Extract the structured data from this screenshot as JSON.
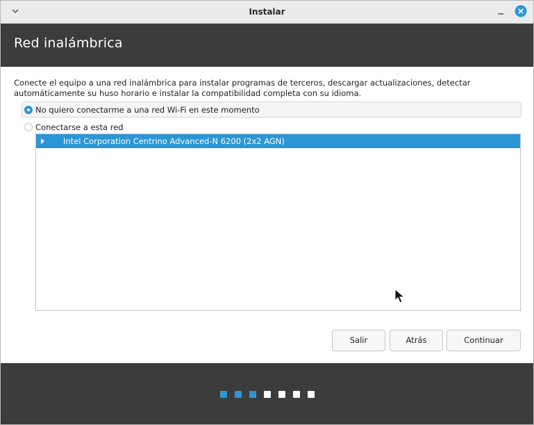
{
  "window": {
    "title": "Instalar"
  },
  "header": {
    "title": "Red inalámbrica"
  },
  "description": "Conecte el equipo a una red inalámbrica para instalar programas de terceros, descargar actualizaciones, detectar automáticamente su huso horario e instalar la compatibilidad completa con su idioma.",
  "options": [
    {
      "label": "No quiero conectarme a una red Wi-Fi en este momento",
      "selected": true
    },
    {
      "label": "Conectarse a esta red",
      "selected": false
    }
  ],
  "network_list": [
    {
      "label": "Intel Corporation Centrino Advanced-N 6200 (2x2 AGN)",
      "selected": true,
      "expanded": false
    }
  ],
  "buttons": {
    "quit": "Salir",
    "back": "Atrás",
    "continue": "Continuar"
  },
  "progress": {
    "total_steps": 7,
    "completed_steps": 3
  },
  "colors": {
    "accent": "#2b96d6",
    "header_bg": "#3c3c3c",
    "dot_inactive": "#ffffff"
  },
  "icons": {
    "menu": "chevron-down-icon",
    "minimize": "minimize-icon",
    "close": "close-icon",
    "expander": "triangle-right-icon",
    "cursor": "mouse-pointer-icon"
  }
}
